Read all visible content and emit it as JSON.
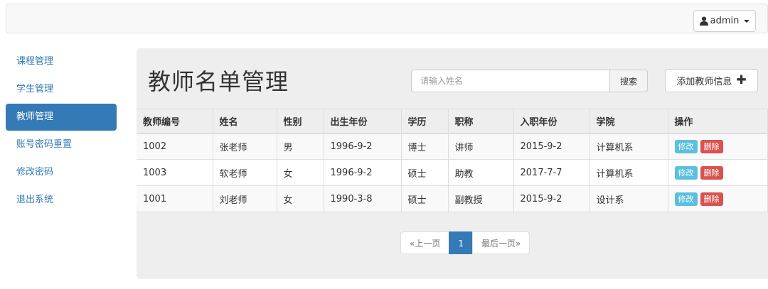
{
  "navbar": {
    "user_label": "admin",
    "user_icon": "user-icon",
    "caret_icon": "caret-down-icon"
  },
  "sidebar": {
    "items": [
      {
        "label": "课程管理",
        "active": false
      },
      {
        "label": "学生管理",
        "active": false
      },
      {
        "label": "教师管理",
        "active": true
      },
      {
        "label": "账号密码重置",
        "active": false
      },
      {
        "label": "修改密码",
        "active": false
      },
      {
        "label": "退出系统",
        "active": false
      }
    ]
  },
  "main": {
    "title": "教师名单管理",
    "search": {
      "placeholder": "请输入姓名",
      "button_label": "搜索"
    },
    "add_button_label": "添加教师信息",
    "add_icon": "plus-icon"
  },
  "table": {
    "headers": [
      "教师编号",
      "姓名",
      "性别",
      "出生年份",
      "学历",
      "职称",
      "入职年份",
      "学院",
      "操作"
    ],
    "rows": [
      {
        "id": "1002",
        "name": "张老师",
        "gender": "男",
        "birth": "1996-9-2",
        "degree": "博士",
        "title": "讲师",
        "hired": "2015-9-2",
        "college": "计算机系",
        "edit": "修改",
        "delete": "删除"
      },
      {
        "id": "1003",
        "name": "软老师",
        "gender": "女",
        "birth": "1996-9-2",
        "degree": "硕士",
        "title": "助教",
        "hired": "2017-7-7",
        "college": "计算机系",
        "edit": "修改",
        "delete": "删除"
      },
      {
        "id": "1001",
        "name": "刘老师",
        "gender": "女",
        "birth": "1990-3-8",
        "degree": "硕士",
        "title": "副教授",
        "hired": "2015-9-2",
        "college": "设计系",
        "edit": "修改",
        "delete": "删除"
      }
    ]
  },
  "pagination": {
    "prev": "«上一页",
    "current": "1",
    "last": "最后一页»"
  },
  "colors": {
    "primary": "#337ab7",
    "info": "#5bc0de",
    "danger": "#d9534f",
    "panel_bg": "#eeeeee"
  }
}
